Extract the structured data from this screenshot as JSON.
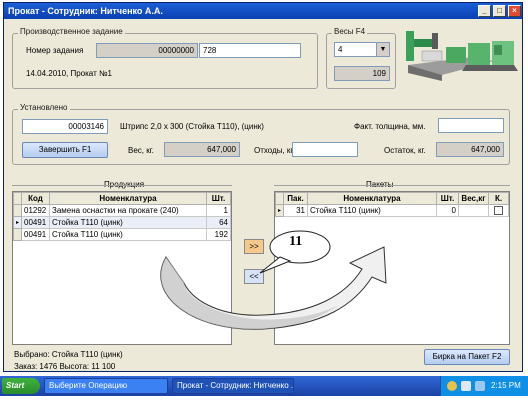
{
  "window": {
    "title": "Прокат - Сотрудник: Нитченко А.А."
  },
  "production": {
    "group_label": "Производственное задание",
    "order_label": "Номер задания",
    "order_value": "00000000",
    "order_value2": "728",
    "info": "14.04.2010, Прокат №1"
  },
  "weights": {
    "group_label": "Весы  F4",
    "selected": "4",
    "value": "109"
  },
  "installed": {
    "group_label": "Установлено",
    "code": "00003146",
    "product": "Штрипс 2,0 x 300 (Стойка Т110), (цинк)",
    "thickness_label": "Факт. толщина, мм.",
    "thickness_value": "",
    "finish_label": "Завершить     F1",
    "weight_label": "Вес, кг.",
    "weight_value": "647,000",
    "waste_label": "Отходы, кг.",
    "waste_value": "",
    "rest_label": "Остаток, кг.",
    "rest_value": "647,000"
  },
  "products": {
    "label": "Продукция",
    "headers": [
      "Код",
      "Номенклатура",
      "Шт."
    ],
    "rows": [
      [
        "01292",
        "Замена оснастки на прокате (240)",
        "1"
      ],
      [
        "00491",
        "Стойка Т110 (цинк)",
        "64"
      ],
      [
        "00491",
        "Стойка Т110 (цинк)",
        "192"
      ]
    ]
  },
  "packages": {
    "label": "Пакеты",
    "headers": [
      "Пак.",
      "Номенклатура",
      "Шт.",
      "Вес,кг",
      "К."
    ],
    "rows": [
      [
        "31",
        "Стойка Т110 (цинк)",
        "0",
        ""
      ]
    ]
  },
  "transfer": {
    "right": ">>",
    "left": "<<"
  },
  "callout": {
    "number": "11"
  },
  "footer": {
    "selected": "Выбрано: Стойка Т110 (цинк)",
    "order_info": "Заказ: 1476  Высота: 11 100",
    "tag_button": "Бирка на Пакет   F2"
  },
  "taskbar": {
    "start": "Start",
    "items": [
      "Выберите Операцию",
      "Прокат - Сотрудник: Нитченко ..."
    ],
    "clock": "2:15 PM"
  },
  "colors": {
    "accent": "#0b3fb0",
    "highlight_button": "#f5c98b"
  }
}
